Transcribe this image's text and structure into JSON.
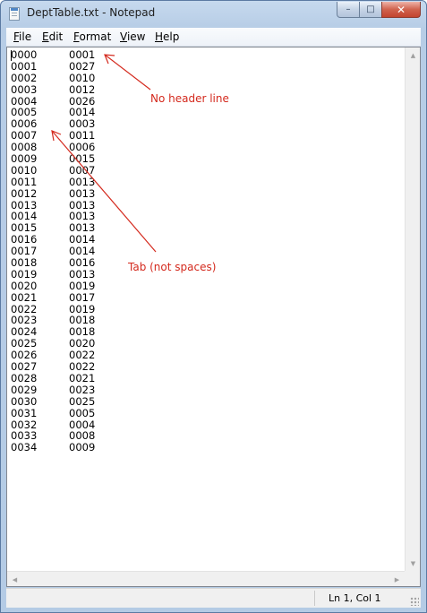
{
  "window": {
    "title": "DeptTable.txt - Notepad",
    "caption_buttons": {
      "minimize": "–",
      "maximize": "□",
      "close": "✕"
    }
  },
  "menu": [
    {
      "first": "F",
      "rest": "ile"
    },
    {
      "first": "E",
      "rest": "dit"
    },
    {
      "first": "F",
      "rest": "ormat"
    },
    {
      "first": "V",
      "rest": "iew"
    },
    {
      "first": "H",
      "rest": "elp"
    }
  ],
  "document": {
    "rows": [
      [
        "0000",
        "0001"
      ],
      [
        "0001",
        "0027"
      ],
      [
        "0002",
        "0010"
      ],
      [
        "0003",
        "0012"
      ],
      [
        "0004",
        "0026"
      ],
      [
        "0005",
        "0014"
      ],
      [
        "0006",
        "0003"
      ],
      [
        "0007",
        "0011"
      ],
      [
        "0008",
        "0006"
      ],
      [
        "0009",
        "0015"
      ],
      [
        "0010",
        "0007"
      ],
      [
        "0011",
        "0013"
      ],
      [
        "0012",
        "0013"
      ],
      [
        "0013",
        "0013"
      ],
      [
        "0014",
        "0013"
      ],
      [
        "0015",
        "0013"
      ],
      [
        "0016",
        "0014"
      ],
      [
        "0017",
        "0014"
      ],
      [
        "0018",
        "0016"
      ],
      [
        "0019",
        "0013"
      ],
      [
        "0020",
        "0019"
      ],
      [
        "0021",
        "0017"
      ],
      [
        "0022",
        "0019"
      ],
      [
        "0023",
        "0018"
      ],
      [
        "0024",
        "0018"
      ],
      [
        "0025",
        "0020"
      ],
      [
        "0026",
        "0022"
      ],
      [
        "0027",
        "0022"
      ],
      [
        "0028",
        "0021"
      ],
      [
        "0029",
        "0023"
      ],
      [
        "0030",
        "0025"
      ],
      [
        "0031",
        "0005"
      ],
      [
        "0032",
        "0004"
      ],
      [
        "0033",
        "0008"
      ],
      [
        "0034",
        "0009"
      ]
    ]
  },
  "annotations": {
    "header_note": "No header line",
    "tab_note": "Tab (not spaces)",
    "color": "#d42a1e"
  },
  "statusbar": {
    "position": "Ln 1, Col 1"
  },
  "icons": {
    "app": "notepad-icon",
    "scroll_up": "▲",
    "scroll_down": "▼",
    "scroll_left": "◀",
    "scroll_right": "▶"
  }
}
